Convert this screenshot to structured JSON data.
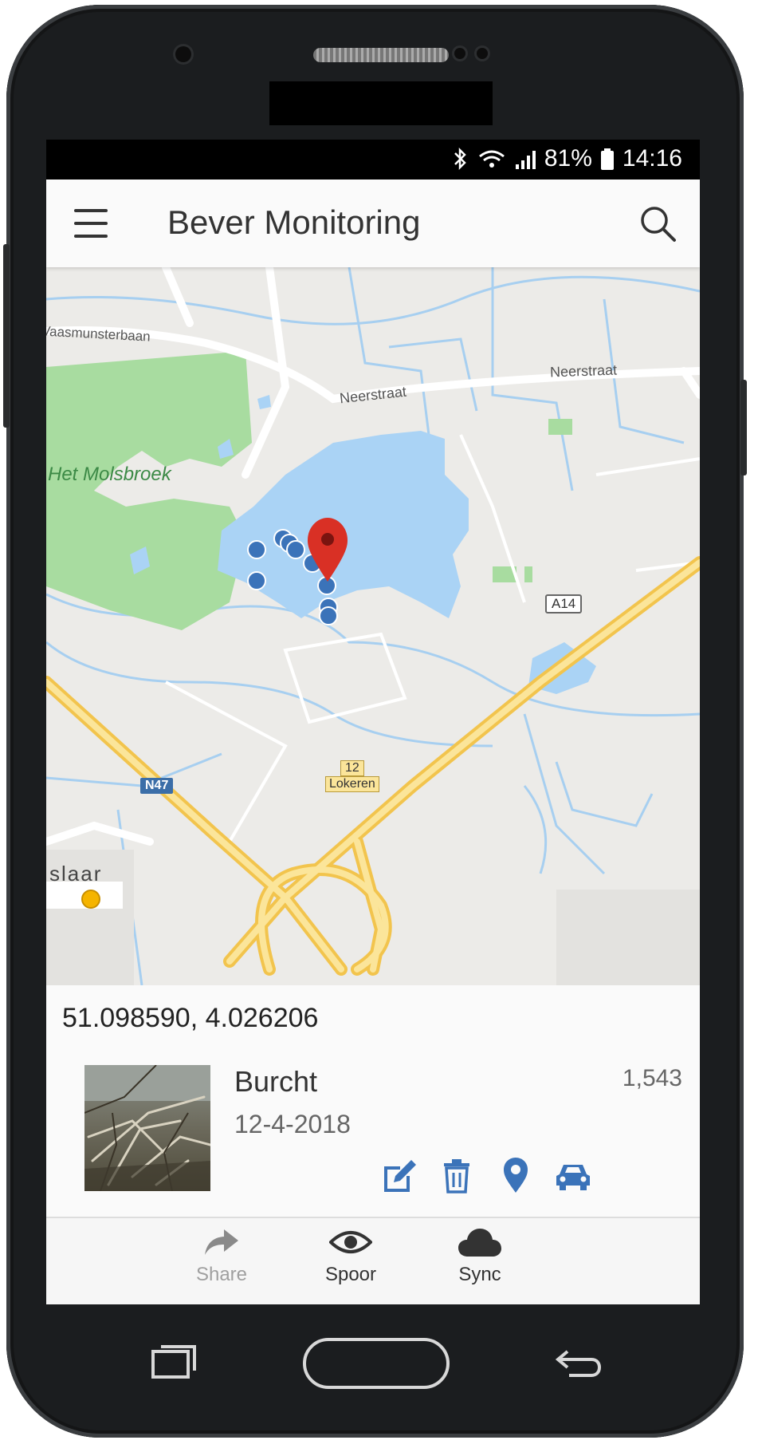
{
  "status_bar": {
    "battery": "81%",
    "time": "14:16"
  },
  "app_bar": {
    "title": "Bever Monitoring"
  },
  "map": {
    "labels": {
      "road_top_left": "Vaasmunsterbaan",
      "road_neerstraat_1": "Neerstraat",
      "road_neerstraat_2": "Neerstraat",
      "park": "Het Molsbroek",
      "highway_a14": "A14",
      "road_n47": "N47",
      "exit_number": "12",
      "exit_name": "Lokeren",
      "place_bottom_left": "slaar"
    },
    "colors": {
      "water": "#aad3f5",
      "park": "#a8dca0",
      "highway": "#f7d77a",
      "marker": "#3b73b9",
      "pin": "#d93025"
    }
  },
  "coordinates": "51.098590, 4.026206",
  "record": {
    "name": "Burcht",
    "date": "12-4-2018",
    "count": "1,543",
    "actions": [
      "edit-icon",
      "trash-icon",
      "location-icon",
      "car-icon"
    ]
  },
  "bottom_nav": {
    "share": "Share",
    "spoor": "Spoor",
    "sync": "Sync"
  },
  "accent_color": "#3b73b9"
}
